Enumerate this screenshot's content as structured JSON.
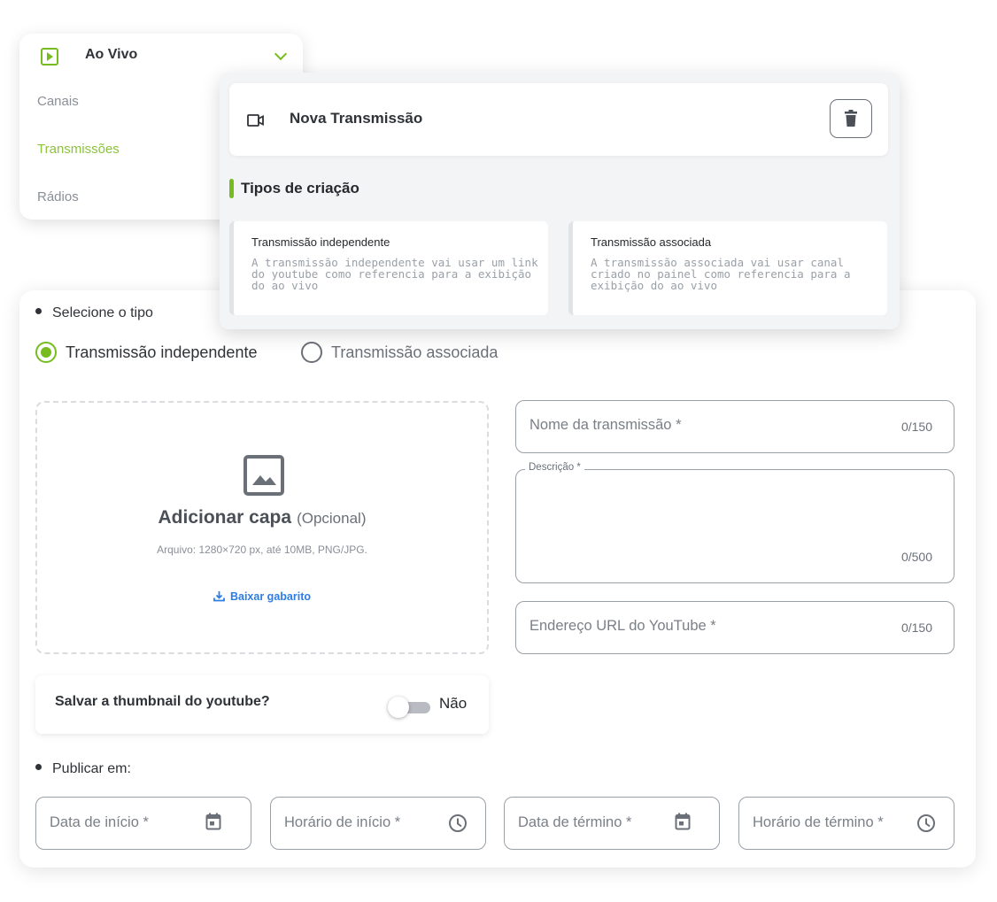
{
  "sidebar": {
    "section_title": "Ao Vivo",
    "items": [
      {
        "label": "Canais",
        "active": false
      },
      {
        "label": "Transmissões",
        "active": true
      },
      {
        "label": "Rádios",
        "active": false
      }
    ],
    "accent_color": "#76bc1f"
  },
  "new_panel": {
    "title": "Nova Transmissão",
    "section_title": "Tipos de criação",
    "types": [
      {
        "title": "Transmissão independente",
        "description": "A transmissão independente vai usar um link do youtube como referencia para a exibição do ao vivo"
      },
      {
        "title": "Transmissão associada",
        "description": "A transmissão associada vai usar canal criado no painel como referencia para a exibição do ao vivo"
      }
    ]
  },
  "form": {
    "select_type_label": "Selecione o tipo",
    "radio_options": [
      {
        "label": "Transmissão independente",
        "checked": true
      },
      {
        "label": "Transmissão associada",
        "checked": false
      }
    ],
    "cover": {
      "title": "Adicionar capa",
      "optional": "(Opcional)",
      "hint": "Arquivo: 1280×720 px, até 10MB, PNG/JPG.",
      "download_label": "Baixar gabarito"
    },
    "thumbnail": {
      "label": "Salvar a thumbnail do youtube?",
      "toggle_value": "Não",
      "enabled": false
    },
    "name_field": {
      "placeholder": "Nome da transmissão *",
      "counter": "0/150"
    },
    "description_field": {
      "label": "Descrição *",
      "counter": "0/500"
    },
    "youtube_field": {
      "placeholder": "Endereço URL do YouTube *",
      "counter": "0/150"
    },
    "publish_label": "Publicar em:",
    "schedule_fields": [
      {
        "placeholder": "Data de início *",
        "icon": "calendar-icon"
      },
      {
        "placeholder": "Horário de início *",
        "icon": "clock-icon"
      },
      {
        "placeholder": "Data de término *",
        "icon": "calendar-icon"
      },
      {
        "placeholder": "Horário de término *",
        "icon": "clock-icon"
      }
    ],
    "link_color": "#2c7de4"
  }
}
